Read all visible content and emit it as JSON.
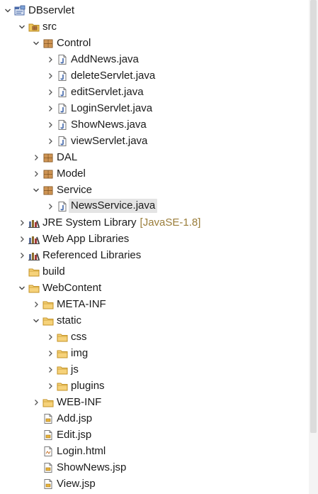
{
  "tree": [
    {
      "label": "DBservlet",
      "icon": "project-icon",
      "depth": 0,
      "twisty": "expanded",
      "name": "project-dbservlet"
    },
    {
      "label": "src",
      "icon": "source-folder-icon",
      "depth": 1,
      "twisty": "expanded",
      "name": "source-folder-src"
    },
    {
      "label": "Control",
      "icon": "package-icon",
      "depth": 2,
      "twisty": "expanded",
      "name": "package-control"
    },
    {
      "label": "AddNews.java",
      "icon": "java-file-icon",
      "depth": 3,
      "twisty": "collapsed",
      "name": "file-addnews-java"
    },
    {
      "label": "deleteServlet.java",
      "icon": "java-file-icon",
      "depth": 3,
      "twisty": "collapsed",
      "name": "file-deleteservlet-java"
    },
    {
      "label": "editServlet.java",
      "icon": "java-file-icon",
      "depth": 3,
      "twisty": "collapsed",
      "name": "file-editservlet-java"
    },
    {
      "label": "LoginServlet.java",
      "icon": "java-file-icon",
      "depth": 3,
      "twisty": "collapsed",
      "name": "file-loginservlet-java"
    },
    {
      "label": "ShowNews.java",
      "icon": "java-file-icon",
      "depth": 3,
      "twisty": "collapsed",
      "name": "file-shownews-java"
    },
    {
      "label": "viewServlet.java",
      "icon": "java-file-icon",
      "depth": 3,
      "twisty": "collapsed",
      "name": "file-viewservlet-java"
    },
    {
      "label": "DAL",
      "icon": "package-icon",
      "depth": 2,
      "twisty": "collapsed",
      "name": "package-dal"
    },
    {
      "label": "Model",
      "icon": "package-icon",
      "depth": 2,
      "twisty": "collapsed",
      "name": "package-model"
    },
    {
      "label": "Service",
      "icon": "package-icon",
      "depth": 2,
      "twisty": "expanded",
      "name": "package-service"
    },
    {
      "label": "NewsService.java",
      "icon": "java-file-icon",
      "depth": 3,
      "twisty": "collapsed",
      "name": "file-newsservice-java",
      "selected": true
    },
    {
      "label": "JRE System Library",
      "decoration": "[JavaSE-1.8]",
      "icon": "library-icon",
      "depth": 1,
      "twisty": "collapsed",
      "name": "library-jre-system"
    },
    {
      "label": "Web App Libraries",
      "icon": "library-icon",
      "depth": 1,
      "twisty": "collapsed",
      "name": "library-web-app"
    },
    {
      "label": "Referenced Libraries",
      "icon": "library-icon",
      "depth": 1,
      "twisty": "collapsed",
      "name": "library-referenced"
    },
    {
      "label": "build",
      "icon": "folder-icon",
      "depth": 1,
      "twisty": "none",
      "name": "folder-build"
    },
    {
      "label": "WebContent",
      "icon": "folder-icon",
      "depth": 1,
      "twisty": "expanded",
      "name": "folder-webcontent"
    },
    {
      "label": "META-INF",
      "icon": "folder-icon",
      "depth": 2,
      "twisty": "collapsed",
      "name": "folder-meta-inf"
    },
    {
      "label": "static",
      "icon": "folder-icon",
      "depth": 2,
      "twisty": "expanded",
      "name": "folder-static"
    },
    {
      "label": "css",
      "icon": "folder-icon",
      "depth": 3,
      "twisty": "collapsed",
      "name": "folder-css"
    },
    {
      "label": "img",
      "icon": "folder-icon",
      "depth": 3,
      "twisty": "collapsed",
      "name": "folder-img"
    },
    {
      "label": "js",
      "icon": "folder-icon",
      "depth": 3,
      "twisty": "collapsed",
      "name": "folder-js"
    },
    {
      "label": "plugins",
      "icon": "folder-icon",
      "depth": 3,
      "twisty": "collapsed",
      "name": "folder-plugins"
    },
    {
      "label": "WEB-INF",
      "icon": "folder-icon",
      "depth": 2,
      "twisty": "collapsed",
      "name": "folder-web-inf"
    },
    {
      "label": "Add.jsp",
      "icon": "jsp-file-icon",
      "depth": 2,
      "twisty": "none",
      "name": "file-add-jsp"
    },
    {
      "label": "Edit.jsp",
      "icon": "jsp-file-icon",
      "depth": 2,
      "twisty": "none",
      "name": "file-edit-jsp"
    },
    {
      "label": "Login.html",
      "icon": "html-file-icon",
      "depth": 2,
      "twisty": "none",
      "name": "file-login-html"
    },
    {
      "label": "ShowNews.jsp",
      "icon": "jsp-file-icon",
      "depth": 2,
      "twisty": "none",
      "name": "file-shownews-jsp"
    },
    {
      "label": "View.jsp",
      "icon": "jsp-file-icon",
      "depth": 2,
      "twisty": "none",
      "name": "file-view-jsp"
    }
  ],
  "colors": {
    "selection": "#e4e4e4",
    "decoration": "#9a7d3a",
    "folder": "#e8b84a",
    "package": "#b5854a",
    "java_file": "#3d63a8",
    "library": "#6b5a2a"
  }
}
